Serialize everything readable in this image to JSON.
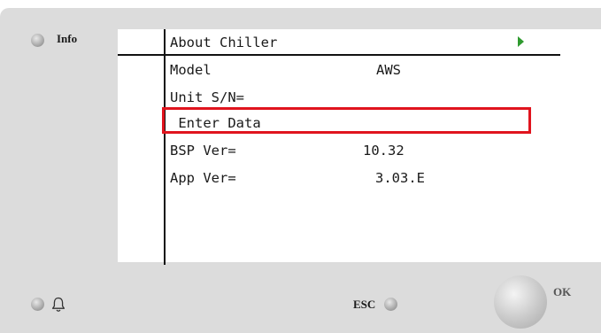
{
  "device": {
    "info_button_label": "Info",
    "esc_button_label": "ESC",
    "ok_button_label": "OK"
  },
  "screen": {
    "title": "About Chiller",
    "rows": [
      {
        "label": "Model",
        "value": "AWS"
      },
      {
        "label": "Unit S/N=",
        "value": ""
      },
      {
        "label": " Enter Data",
        "value": ""
      },
      {
        "label": "BSP Ver=",
        "value": "10.32"
      },
      {
        "label": "App Ver=",
        "value": "3.03.E"
      }
    ]
  },
  "colors": {
    "highlight": "#e0141e",
    "arrow": "#2f9a2f"
  },
  "icons": [
    "bell-icon",
    "next-arrow-icon"
  ]
}
